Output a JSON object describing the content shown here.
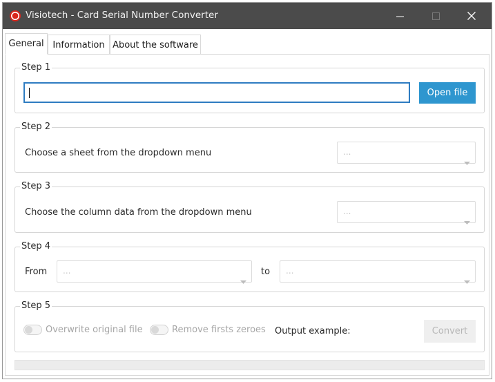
{
  "window": {
    "title": "Visiotech - Card Serial Number Converter",
    "icon": "visiotech-logo-icon",
    "controls": [
      "minimize-icon",
      "maximize-icon",
      "close-icon"
    ]
  },
  "tabs": [
    {
      "label": "General",
      "active": true
    },
    {
      "label": "Information",
      "active": false
    },
    {
      "label": "About the software",
      "active": false
    }
  ],
  "step1": {
    "label": "Step 1",
    "file_path_value": "",
    "open_button": "Open file"
  },
  "step2": {
    "label": "Step 2",
    "prompt": "Choose a sheet from the dropdown menu",
    "select_value": "..."
  },
  "step3": {
    "label": "Step 3",
    "prompt": "Choose the column data from the dropdown menu",
    "select_value": "..."
  },
  "step4": {
    "label": "Step 4",
    "from_label": "From",
    "from_value": "...",
    "to_label": "to",
    "to_value": "..."
  },
  "step5": {
    "label": "Step 5",
    "overwrite_label": "Overwrite original file",
    "overwrite_on": false,
    "remove_zeroes_label": "Remove firsts zeroes",
    "remove_zeroes_on": false,
    "output_example_label": "Output example:",
    "output_example_value": "",
    "convert_button": "Convert"
  },
  "progress": {
    "value": 0
  },
  "colors": {
    "titlebar": "#4b4b4b",
    "accent": "#2e96cf",
    "input_focus": "#2e7cc1",
    "logo_red": "#d9261c"
  }
}
